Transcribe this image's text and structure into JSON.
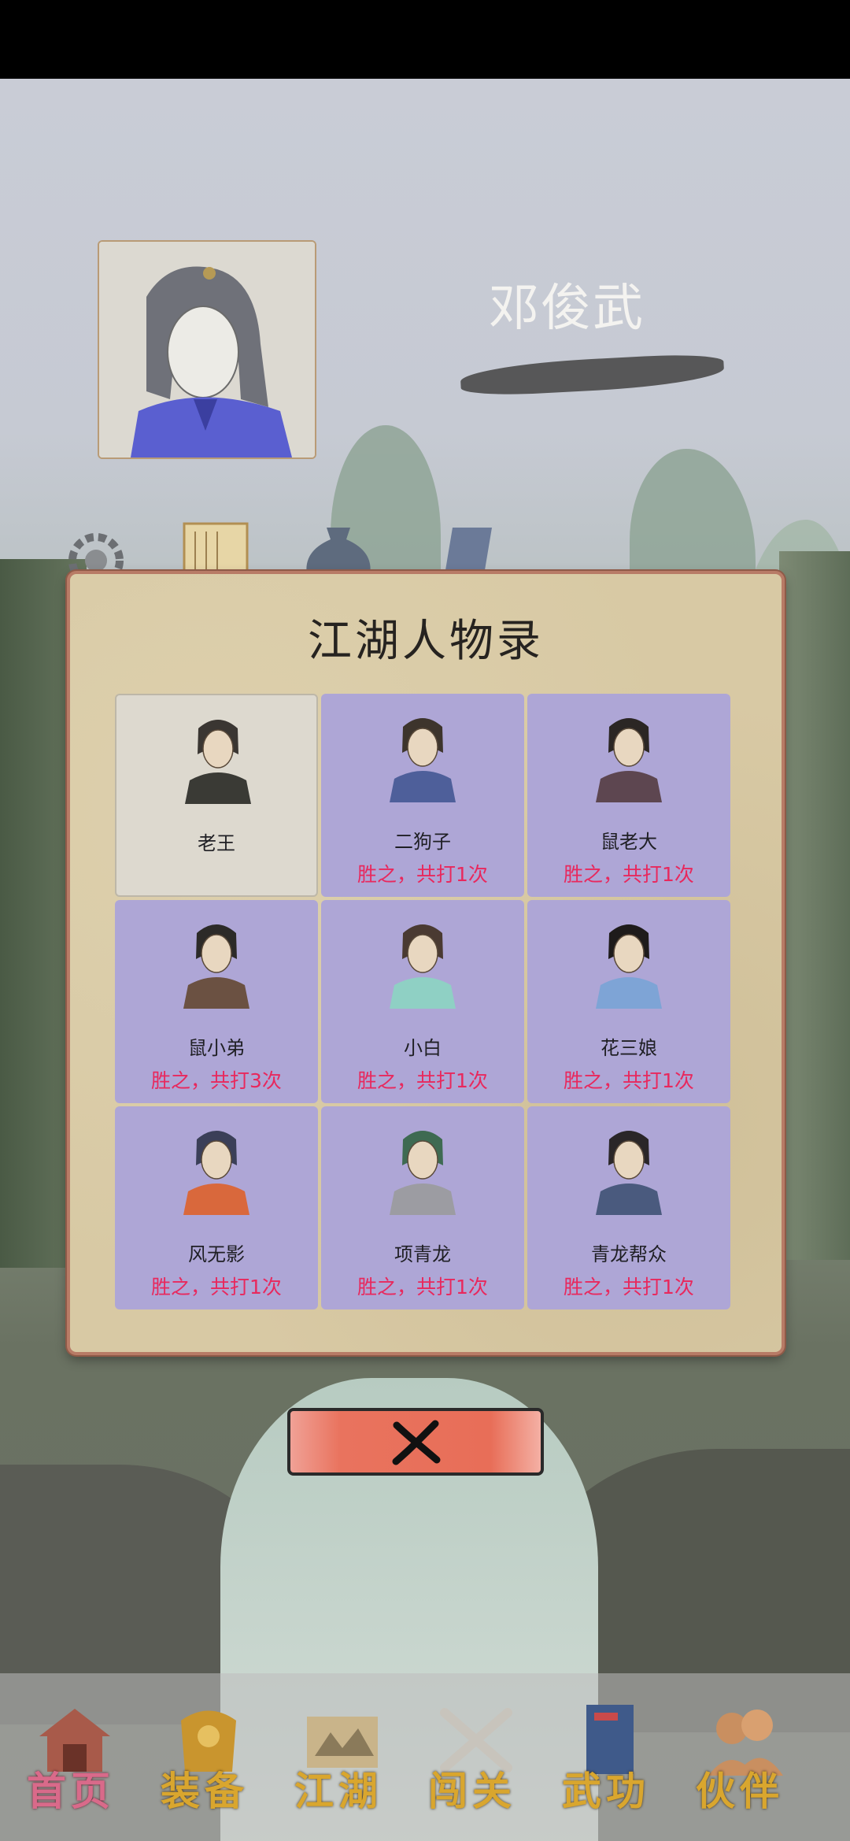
{
  "player": {
    "name": "邓俊武"
  },
  "modal": {
    "title": "江湖人物录",
    "characters": [
      {
        "name": "老王",
        "record": "",
        "defeated": false,
        "robe": "#3a3a35",
        "hair": "#3a3632"
      },
      {
        "name": "二狗子",
        "record": "胜之，共打1次",
        "defeated": true,
        "robe": "#4e5f9a",
        "hair": "#3d342c"
      },
      {
        "name": "鼠老大",
        "record": "胜之，共打1次",
        "defeated": true,
        "robe": "#5d4650",
        "hair": "#2b2624"
      },
      {
        "name": "鼠小弟",
        "record": "胜之，共打3次",
        "defeated": true,
        "robe": "#6b5142",
        "hair": "#2c2a28"
      },
      {
        "name": "小白",
        "record": "胜之，共打1次",
        "defeated": true,
        "robe": "#8fd0c4",
        "hair": "#4a3a32"
      },
      {
        "name": "花三娘",
        "record": "胜之，共打1次",
        "defeated": true,
        "robe": "#7ea4d6",
        "hair": "#1e1b1b"
      },
      {
        "name": "风无影",
        "record": "胜之，共打1次",
        "defeated": true,
        "robe": "#d9683c",
        "hair": "#3b3f58"
      },
      {
        "name": "项青龙",
        "record": "胜之，共打1次",
        "defeated": true,
        "robe": "#9c9ca2",
        "hair": "#3e6a52"
      },
      {
        "name": "青龙帮众",
        "record": "胜之，共打1次",
        "defeated": true,
        "robe": "#4a5a7e",
        "hair": "#2a2628"
      }
    ]
  },
  "close_button": {
    "icon": "x-icon"
  },
  "nav": [
    {
      "label": "首页",
      "icon": "house-icon",
      "active": true
    },
    {
      "label": "装备",
      "icon": "armor-icon",
      "active": false
    },
    {
      "label": "江湖",
      "icon": "map-scroll-icon",
      "active": false
    },
    {
      "label": "闯关",
      "icon": "swords-icon",
      "active": false
    },
    {
      "label": "武功",
      "icon": "book-icon",
      "active": false
    },
    {
      "label": "伙伴",
      "icon": "companions-icon",
      "active": false
    }
  ],
  "colors": {
    "record_text": "#e8285d",
    "cell_bg": "#aea6d6",
    "nav_label": "#d9a62e",
    "nav_label_active": "#d96a8a",
    "close_button": "#e86e58"
  }
}
